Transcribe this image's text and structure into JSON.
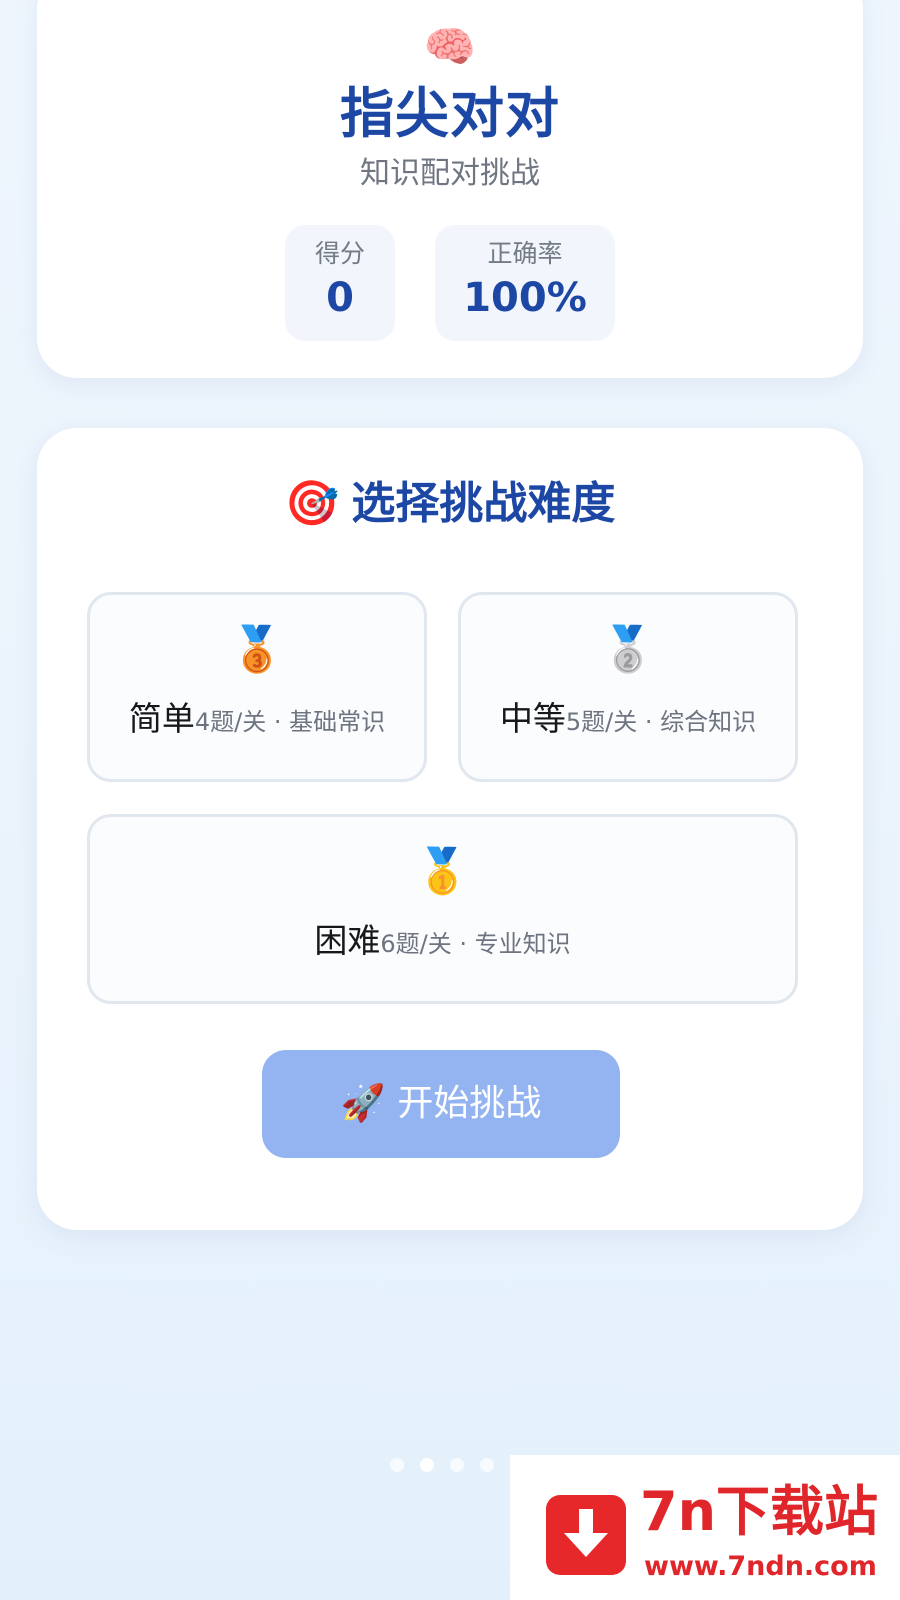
{
  "header": {
    "brain_icon": "🧠",
    "title": "指尖对对",
    "subtitle": "知识配对挑战",
    "stats": {
      "score_label": "得分",
      "score_value": "0",
      "accuracy_label": "正确率",
      "accuracy_value": "100%"
    }
  },
  "difficulty": {
    "target_icon": "🎯",
    "title": "选择挑战难度",
    "options": [
      {
        "medal": "🥉",
        "name": "简单",
        "desc": "4题/关 · 基础常识"
      },
      {
        "medal": "🥈",
        "name": "中等",
        "desc": "5题/关 · 综合知识"
      },
      {
        "medal": "🥇",
        "name": "困难",
        "desc": "6题/关 · 专业知识"
      }
    ],
    "start_icon": "🚀",
    "start_label": "开始挑战"
  },
  "pager": {
    "count": 4,
    "active_index": 1
  },
  "watermark": {
    "name": "7n下载站",
    "url": "www.7ndn.com",
    "color": "#e0262a"
  },
  "colors": {
    "accent": "#1d47a5",
    "button": "#93b4f1"
  }
}
